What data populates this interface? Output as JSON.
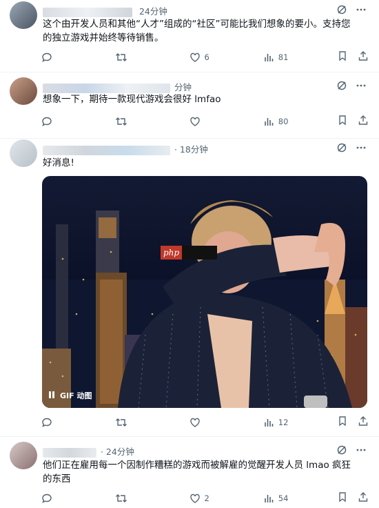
{
  "tweets": [
    {
      "time": "24分钟",
      "text": "这个由开发人员和其他“人才”组成的“社区”可能比我们想象的要小。支持您的独立游戏并始终等待销售。",
      "stats": {
        "reply": "",
        "retweet": "",
        "like": "6",
        "views": "81"
      }
    },
    {
      "time": "分钟",
      "text": "想象一下，期待一款现代游戏会很好 lmfao",
      "stats": {
        "reply": "",
        "retweet": "",
        "like": "",
        "views": "80"
      }
    },
    {
      "time": "· 18分钟",
      "text": "好消息!",
      "media": {
        "gif_label": "GIF 动图",
        "watermark": "php"
      },
      "stats": {
        "reply": "",
        "retweet": "",
        "like": "",
        "views": "12"
      }
    },
    {
      "time": "· 24分钟",
      "text": "他们正在雇用每一个因制作糟糕的游戏而被解雇的觉醒开发人员 lmao 疯狂的东西",
      "stats": {
        "reply": "",
        "retweet": "",
        "like": "2",
        "views": "54"
      }
    }
  ],
  "icons": {
    "reply": "reply-icon",
    "retweet": "retweet-icon",
    "like": "like-icon",
    "views": "views-icon",
    "bookmark": "bookmark-icon",
    "share": "share-icon",
    "grok": "grok-icon",
    "more": "more-icon"
  },
  "colors": {
    "text": "#0f1419",
    "secondary": "#536471",
    "divider": "#eff3f4"
  }
}
